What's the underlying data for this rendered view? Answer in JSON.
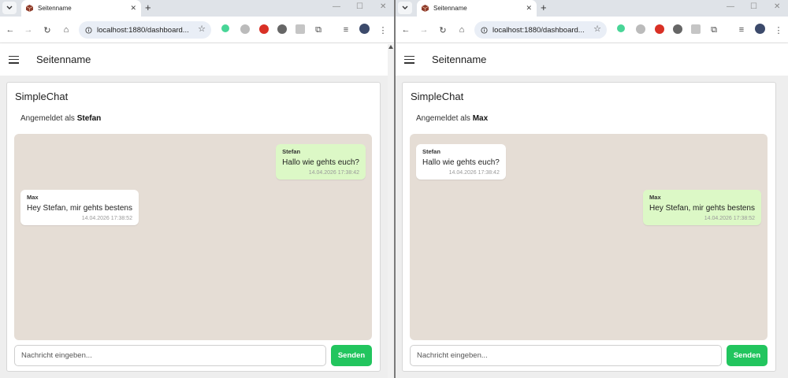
{
  "windows": [
    {
      "tab": {
        "title": "Seitenname"
      },
      "toolbar": {
        "url": "localhost:1880/dashboard..."
      },
      "app": {
        "title": "Seitenname"
      },
      "card": {
        "title": "SimpleChat",
        "logged_prefix": "Angemeldet als",
        "logged_user": "Stefan"
      },
      "messages": [
        {
          "author": "Stefan",
          "text": "Hallo wie gehts euch?",
          "time": "14.04.2026 17:38:42",
          "own": true
        },
        {
          "author": "Max",
          "text": "Hey Stefan, mir gehts bestens",
          "time": "14.04.2026 17:38:52",
          "own": false
        }
      ],
      "input": {
        "placeholder": "Nachricht eingeben...",
        "value": ""
      },
      "send_label": "Senden"
    },
    {
      "tab": {
        "title": "Seitenname"
      },
      "toolbar": {
        "url": "localhost:1880/dashboard..."
      },
      "app": {
        "title": "Seitenname"
      },
      "card": {
        "title": "SimpleChat",
        "logged_prefix": "Angemeldet als",
        "logged_user": "Max"
      },
      "messages": [
        {
          "author": "Stefan",
          "text": "Hallo wie gehts euch?",
          "time": "14.04.2026 17:38:42",
          "own": false
        },
        {
          "author": "Max",
          "text": "Hey Stefan, mir gehts bestens",
          "time": "14.04.2026 17:38:52",
          "own": true
        }
      ],
      "input": {
        "placeholder": "Nachricht eingeben...",
        "value": ""
      },
      "send_label": "Senden"
    }
  ],
  "colors": {
    "own_bubble": "#dcf8c6",
    "other_bubble": "#ffffff",
    "chat_background": "#e5ddd5",
    "send_button": "#22c55e"
  },
  "icons": [
    "tab-list-icon",
    "favicon-icon",
    "close-icon",
    "plus-icon",
    "minimize-icon",
    "maximize-icon",
    "back-icon",
    "forward-icon",
    "reload-icon",
    "home-icon",
    "site-info-icon",
    "star-icon",
    "extension-icon",
    "puzzle-icon",
    "media-icon",
    "profile-avatar-icon",
    "kebab-menu-icon",
    "hamburger-icon"
  ]
}
